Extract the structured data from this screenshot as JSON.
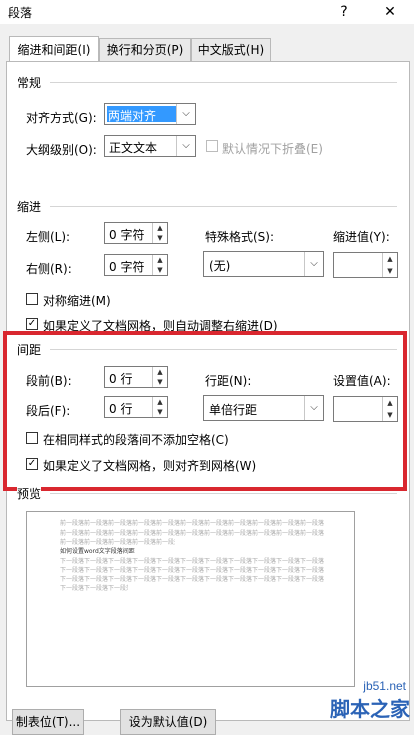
{
  "window": {
    "title": "段落",
    "help": "?",
    "close": "✕"
  },
  "tabs": [
    "缩进和间距(I)",
    "换行和分页(P)",
    "中文版式(H)"
  ],
  "general": {
    "heading": "常规",
    "alignment_label": "对齐方式(G):",
    "alignment_value": "两端对齐",
    "outline_label": "大纲级别(O):",
    "outline_value": "正文文本",
    "collapse_label": "默认情况下折叠(E)"
  },
  "indent": {
    "heading": "缩进",
    "left_label": "左侧(L):",
    "left_value": "0 字符",
    "right_label": "右侧(R):",
    "right_value": "0 字符",
    "special_label": "特殊格式(S):",
    "special_value": "(无)",
    "by_label": "缩进值(Y):",
    "by_value": "",
    "mirror_label": "对称缩进(M)",
    "auto_adjust_label": "如果定义了文档网格，则自动调整右缩进(D)"
  },
  "spacing": {
    "heading": "间距",
    "before_label": "段前(B):",
    "before_value": "0 行",
    "after_label": "段后(F):",
    "after_value": "0 行",
    "line_label": "行距(N):",
    "line_value": "单倍行距",
    "at_label": "设置值(A):",
    "at_value": "",
    "no_space_label": "在相同样式的段落间不添加空格(C)",
    "snap_grid_label": "如果定义了文档网格，则对齐到网格(W)"
  },
  "preview": {
    "heading": "预览",
    "prev_text": "前一段落前一段落前一段落前一段落前一段落前一段落前一段落前一段落前一段落前一段落前一段落",
    "current_text": "如何设置word文字段落间距",
    "next_text": "下一段落下一段落下一段落下一段落下一段落下一段落下一段落下一段落下一段落下一段落下一段落",
    "last_text": "下一段落下一段落下一段落"
  },
  "buttons": {
    "tabs_btn": "制表位(T)...",
    "default_btn": "设为默认值(D)"
  },
  "watermark": {
    "site": "jb51.net",
    "name": "脚本之家"
  },
  "colors": {
    "highlight": "#d9272f",
    "selection": "#3399ff",
    "watermark": "#2b63b6"
  }
}
